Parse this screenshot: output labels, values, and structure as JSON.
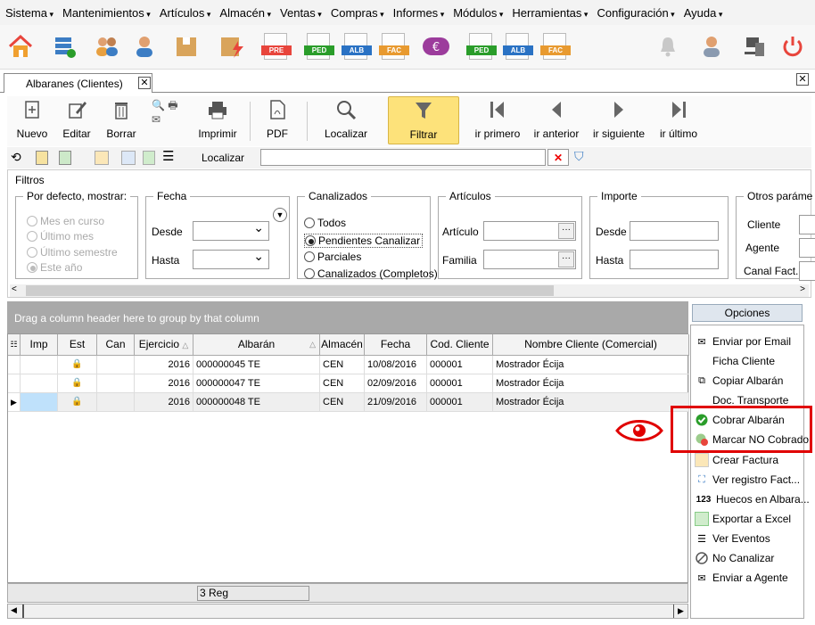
{
  "menu": [
    "Sistema",
    "Mantenimientos",
    "Artículos",
    "Almacén",
    "Ventas",
    "Compras",
    "Informes",
    "Módulos",
    "Herramientas",
    "Configuración",
    "Ayuda"
  ],
  "doc_icons": {
    "pre": "PRE",
    "ped": "PED",
    "alb": "ALB",
    "fac": "FAC"
  },
  "tab": {
    "label": "Albaranes (Clientes)",
    "close": "✕"
  },
  "window_close": "✕",
  "actions": {
    "nuevo": "Nuevo",
    "editar": "Editar",
    "borrar": "Borrar",
    "imprimir": "Imprimir",
    "pdf": "PDF",
    "localizar": "Localizar",
    "filtrar": "Filtrar",
    "ir_primero": "ir primero",
    "ir_anterior": "ir anterior",
    "ir_siguiente": "ir siguiente",
    "ir_ultimo": "ir último"
  },
  "search": {
    "label": "Localizar",
    "value": ""
  },
  "filters": {
    "title": "Filtros",
    "default_show": {
      "legend": "Por defecto, mostrar:",
      "options": [
        "Mes en curso",
        "Último mes",
        "Último semestre",
        "Este año"
      ],
      "selected": 3
    },
    "fecha": {
      "legend": "Fecha",
      "desde": "Desde",
      "hasta": "Hasta"
    },
    "canalizados": {
      "legend": "Canalizados",
      "options": [
        "Todos",
        "Pendientes Canalizar",
        "Parciales",
        "Canalizados (Completos)"
      ],
      "selected": 1
    },
    "articulos": {
      "legend": "Artículos",
      "articulo": "Artículo",
      "familia": "Familia"
    },
    "importe": {
      "legend": "Importe",
      "desde": "Desde",
      "hasta": "Hasta"
    },
    "otros": {
      "legend": "Otros paráme",
      "cliente": "Cliente",
      "agente": "Agente",
      "canal": "Canal Fact."
    }
  },
  "grid": {
    "group_hint": "Drag a column header here to group by that column",
    "columns": [
      "Imp",
      "Est",
      "Can",
      "Ejercicio",
      "Albarán",
      "Almacén",
      "Fecha",
      "Cod. Cliente",
      "Nombre Cliente (Comercial)"
    ],
    "rows": [
      {
        "ejercicio": "2016",
        "albaran": "000000045 TE",
        "almacen": "CEN",
        "fecha": "10/08/2016",
        "cod": "000001",
        "nombre": "Mostrador Écija"
      },
      {
        "ejercicio": "2016",
        "albaran": "000000047 TE",
        "almacen": "CEN",
        "fecha": "02/09/2016",
        "cod": "000001",
        "nombre": "Mostrador Écija"
      },
      {
        "ejercicio": "2016",
        "albaran": "000000048 TE",
        "almacen": "CEN",
        "fecha": "21/09/2016",
        "cod": "000001",
        "nombre": "Mostrador Écija"
      }
    ],
    "count": "3 Reg"
  },
  "options": {
    "header": "Opciones",
    "items": [
      "Enviar por Email",
      "Ficha Cliente",
      "Copiar Albarán",
      "Doc. Transporte",
      "Cobrar Albarán",
      "Marcar NO Cobrado",
      "Crear Factura",
      "Ver registro Fact...",
      "Huecos en Albara...",
      "Exportar a Excel",
      "Ver Eventos",
      "No Canalizar",
      "Enviar a Agente"
    ],
    "huecos_prefix": "123"
  },
  "colors": {
    "highlight": "#e00000",
    "accent_green": "#2a9d2a",
    "doc_red": "#e8453c"
  }
}
